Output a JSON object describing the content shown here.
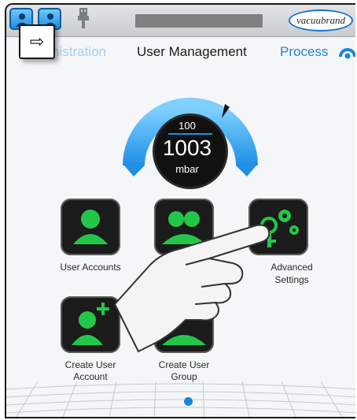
{
  "header": {
    "logo_text": "vacuubrand",
    "arrow_glyph": "⇨"
  },
  "nav": {
    "tab_admin": "nistration",
    "tab_user_management": "User Management",
    "tab_process": "Process"
  },
  "gauge": {
    "setpoint": "100",
    "pressure": "1003",
    "unit": "mbar"
  },
  "tiles": [
    {
      "label": "User Accounts",
      "icon": "user-icon"
    },
    {
      "label": "",
      "icon": "user-group-icon"
    },
    {
      "label": "Advanced Settings",
      "icon": "key-gears-icon"
    },
    {
      "label": "Create User Account",
      "icon": "add-user-icon"
    },
    {
      "label": "Create User Group",
      "icon": "group-icon"
    }
  ],
  "labels": {
    "advanced_line1": "Advanced",
    "advanced_line2": "Settings",
    "create_account_line1": "Create User",
    "create_account_line2": "Account",
    "create_group_line1": "Create User",
    "create_group_line2": "Group"
  },
  "colors": {
    "accent_blue": "#1a86d8",
    "tile_green": "#22c74a",
    "tile_bg": "#1b1b1b"
  },
  "pagination": {
    "current_page": 1
  }
}
